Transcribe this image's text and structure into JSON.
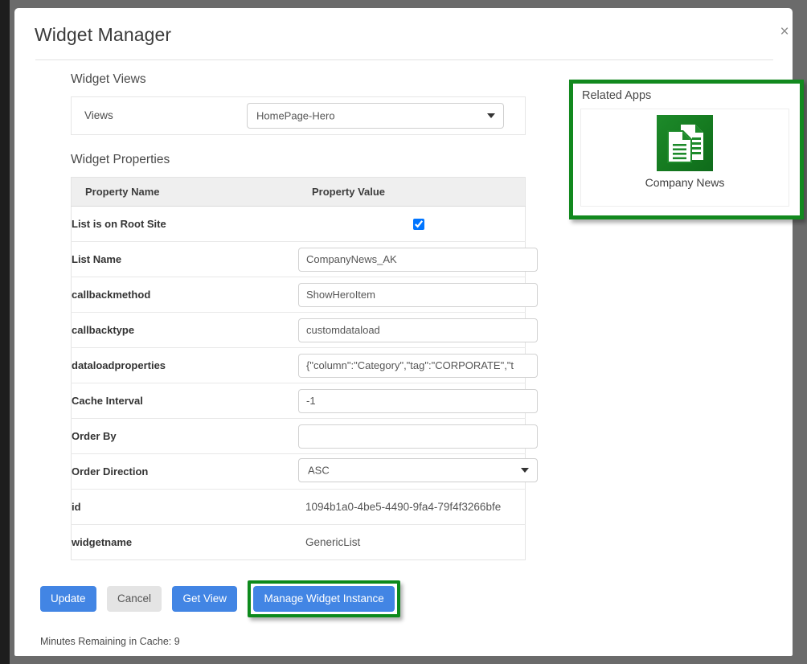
{
  "dialog": {
    "title": "Widget Manager",
    "close_icon": "close-icon",
    "close_glyph": "×"
  },
  "widget_views": {
    "heading": "Widget Views",
    "label": "Views",
    "selected": "HomePage-Hero",
    "caret_icon": "chevron-down-icon"
  },
  "widget_properties": {
    "heading": "Widget Properties",
    "columns": [
      "Property Name",
      "Property Value"
    ],
    "rows": [
      {
        "name": "List is on Root Site",
        "type": "checkbox",
        "checked": true,
        "value": ""
      },
      {
        "name": "List Name",
        "type": "input",
        "value": "CompanyNews_AK"
      },
      {
        "name": "callbackmethod",
        "type": "input",
        "value": "ShowHeroItem"
      },
      {
        "name": "callbacktype",
        "type": "input",
        "value": "customdataload"
      },
      {
        "name": "dataloadproperties",
        "type": "input",
        "value": "{\"column\":\"Category\",\"tag\":\"CORPORATE\",\"t"
      },
      {
        "name": "Cache Interval",
        "type": "input",
        "value": "-1"
      },
      {
        "name": "Order By",
        "type": "input",
        "value": ""
      },
      {
        "name": "Order Direction",
        "type": "select",
        "value": "ASC"
      },
      {
        "name": "id",
        "type": "static",
        "value": "1094b1a0-4be5-4490-9fa4-79f4f3266bfe"
      },
      {
        "name": "widgetname",
        "type": "static",
        "value": "GenericList"
      }
    ]
  },
  "related_apps": {
    "title": "Related Apps",
    "highlight_color": "#12891e",
    "apps": [
      {
        "label": "Company News",
        "icon": "documents-icon",
        "icon_color": "#15802169"
      }
    ]
  },
  "footer": {
    "buttons": [
      {
        "label": "Update",
        "style": "primary"
      },
      {
        "label": "Cancel",
        "style": "default"
      },
      {
        "label": "Get View",
        "style": "primary"
      },
      {
        "label": "Manage Widget Instance",
        "style": "primary",
        "highlighted": true
      }
    ],
    "highlight_color": "#0d8a1c",
    "primary_color": "#4285e4",
    "cache_note": "Minutes Remaining in Cache: 9"
  }
}
